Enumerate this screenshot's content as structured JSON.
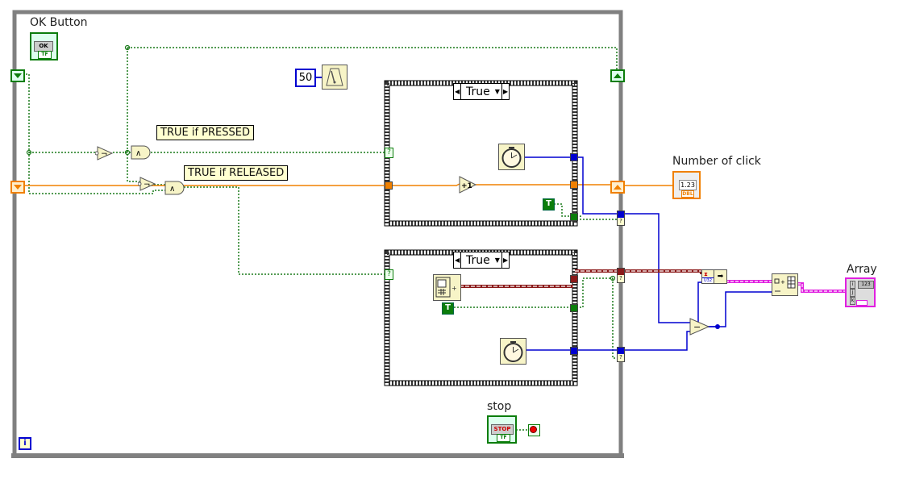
{
  "diagram": {
    "type": "LabVIEW block diagram",
    "while_loop": {
      "iteration_terminal": "i",
      "stop_terminal": "stop-condition"
    },
    "controls": {
      "ok_button": {
        "label": "OK Button",
        "face": "OK",
        "type": "TF"
      },
      "stop_button": {
        "label": "stop",
        "face": "STOP",
        "type": "TF"
      }
    },
    "indicators": {
      "number_of_click": {
        "label": "Number of click",
        "face": "1.23",
        "type": "DBL"
      },
      "array": {
        "label": "Array",
        "face": "123",
        "index_labels": [
          "i",
          "j",
          "k"
        ]
      }
    },
    "constants": {
      "wait_ms": "50",
      "true_const": "T"
    },
    "comments": {
      "pressed": "TRUE if PRESSED",
      "released": "TRUE if RELEASED"
    },
    "case_structures": [
      {
        "selector": "True"
      },
      {
        "selector": "True"
      }
    ],
    "nodes": {
      "not_symbol": "¬",
      "and_symbol": "∧",
      "increment": "+1",
      "subtract": "−",
      "to_u32": "U32"
    },
    "colors": {
      "boolean_wire": "#1a7a1a",
      "numeric_dbl_wire": "#f08000",
      "u32_wire": "#0000d0",
      "timestamp_wire": "#8b1a1a",
      "array_wire": "#e020e0",
      "loop_border": "#808080"
    }
  }
}
